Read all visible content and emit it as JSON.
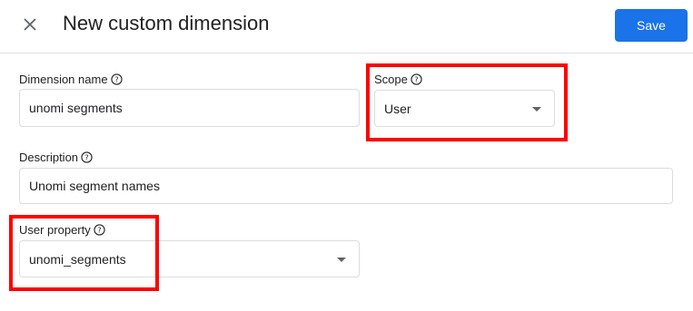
{
  "header": {
    "close_icon": "close-icon",
    "title": "New custom dimension",
    "save_label": "Save",
    "save_color": "#1a73e8"
  },
  "form": {
    "dimension_name": {
      "label": "Dimension name",
      "value": "unomi segments"
    },
    "scope": {
      "label": "Scope",
      "value": "User"
    },
    "description": {
      "label": "Description",
      "value": "Unomi segment names"
    },
    "user_property": {
      "label": "User property",
      "value": "unomi_segments"
    }
  },
  "highlight_color": "#ff0000"
}
